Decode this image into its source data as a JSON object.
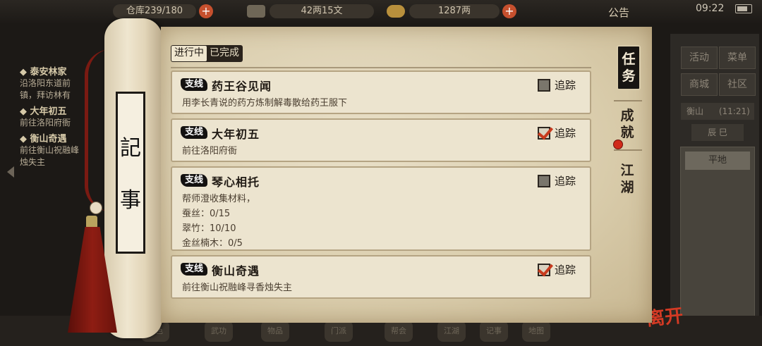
{
  "status_bar": {
    "capacity": "仓库239/180",
    "money": "42两15文",
    "gold": "1287两",
    "notice": "公告",
    "time": "09:22"
  },
  "background_quests": [
    {
      "title": "◆ 泰安林家",
      "desc": [
        "沿洛阳东道前",
        "镇，拜访林有"
      ]
    },
    {
      "title": "◆ 大年初五",
      "desc": [
        "前往洛阳府衙"
      ]
    },
    {
      "title": "◆ 衡山奇遇",
      "desc": [
        "前往衡山祝融峰",
        "烛失主"
      ]
    }
  ],
  "right_panel": {
    "buttons": [
      "活动",
      "菜单",
      "商城",
      "社区"
    ],
    "location": "衡山",
    "location_time": "(11:21)",
    "period": "辰 巳",
    "terrain": "平地"
  },
  "bottom_nav": [
    "角色",
    "武功",
    "物品",
    "门派",
    "帮会",
    "江湖",
    "记事",
    "地图"
  ],
  "leave": "离开",
  "scroll": {
    "chars": [
      "記",
      "事"
    ]
  },
  "tabs": {
    "active": "进行中",
    "inactive": "已完成"
  },
  "side_tabs": [
    {
      "label": "任务",
      "active": true
    },
    {
      "label": "成就",
      "active": false
    },
    {
      "label": "江湖",
      "active": false
    }
  ],
  "track_label": "追踪",
  "quests": [
    {
      "badge": "支线",
      "title": "药王谷见闻",
      "desc": [
        "用李长青说的药方炼制解毒散给药王服下"
      ],
      "tracked": false
    },
    {
      "badge": "支线",
      "title": "大年初五",
      "desc": [
        "前往洛阳府衙"
      ],
      "tracked": true
    },
    {
      "badge": "支线",
      "title": "琴心相托",
      "desc": [
        "帮师澄收集材料，",
        "蚕丝：0/15",
        "翠竹：10/10",
        "金丝楠木：0/5"
      ],
      "tracked": false
    },
    {
      "badge": "支线",
      "title": "衡山奇遇",
      "desc": [
        "前往衡山祝融峰寻香烛失主"
      ],
      "tracked": true
    }
  ]
}
